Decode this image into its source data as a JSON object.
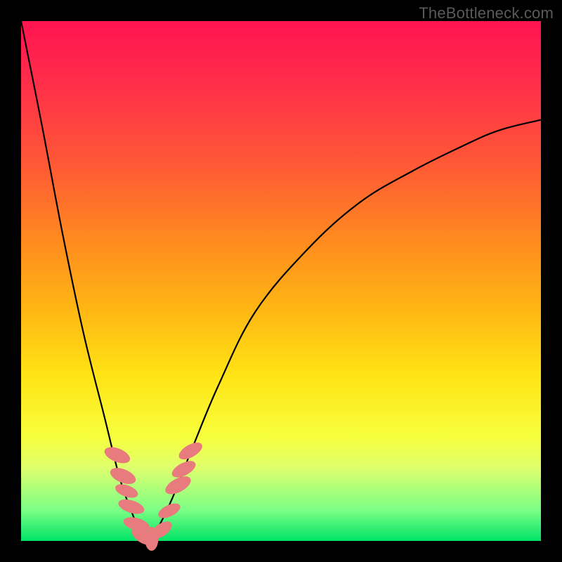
{
  "watermark": "TheBottleneck.com",
  "colors": {
    "frame": "#000000",
    "curve": "#000000",
    "bead": "#e77b7d",
    "gradient_top": "#ff1450",
    "gradient_bottom": "#00e468"
  },
  "chart_data": {
    "type": "line",
    "title": "",
    "xlabel": "",
    "ylabel": "",
    "xlim": [
      0,
      100
    ],
    "ylim": [
      0,
      100
    ],
    "grid": false,
    "legend": false,
    "notes": "Bottleneck-style curve. y≈100 means high bottleneck (top, red), y≈0 is optimal (bottom, green). Minimum of the V sits around x≈24, y≈0. Left arm rises steeply to y≈100 at x≈0; right arm rises to y≈81 at x≈100.",
    "series": [
      {
        "name": "left_arm",
        "x": [
          0,
          4,
          8,
          12,
          16,
          19,
          21.5,
          23,
          24
        ],
        "values": [
          100,
          80,
          59,
          40,
          24,
          12,
          5,
          1.5,
          0
        ]
      },
      {
        "name": "right_arm",
        "x": [
          24,
          26,
          29,
          33,
          38,
          45,
          55,
          65,
          75,
          85,
          92,
          100
        ],
        "values": [
          0,
          2,
          8,
          18,
          30,
          44,
          56,
          65,
          71,
          76,
          79,
          81
        ]
      }
    ],
    "beads": {
      "note": "Salmon lozenge beads clustered near the V bottom on both arms.",
      "points": [
        {
          "x": 18.5,
          "y": 16.5,
          "rx": 1.3,
          "ry": 2.6,
          "rot": -68
        },
        {
          "x": 19.6,
          "y": 12.5,
          "rx": 1.3,
          "ry": 2.6,
          "rot": -68
        },
        {
          "x": 20.3,
          "y": 9.6,
          "rx": 1.1,
          "ry": 2.3,
          "rot": -70
        },
        {
          "x": 21.2,
          "y": 6.6,
          "rx": 1.2,
          "ry": 2.6,
          "rot": -72
        },
        {
          "x": 22.2,
          "y": 3.2,
          "rx": 1.2,
          "ry": 2.6,
          "rot": -74
        },
        {
          "x": 23.3,
          "y": 0.9,
          "rx": 1.2,
          "ry": 2.3,
          "rot": -55
        },
        {
          "x": 25.1,
          "y": 0.4,
          "rx": 1.3,
          "ry": 2.3,
          "rot": 0
        },
        {
          "x": 27.0,
          "y": 2.1,
          "rx": 1.2,
          "ry": 2.3,
          "rot": 55
        },
        {
          "x": 28.5,
          "y": 5.8,
          "rx": 1.1,
          "ry": 2.3,
          "rot": 64
        },
        {
          "x": 30.2,
          "y": 10.7,
          "rx": 1.3,
          "ry": 2.7,
          "rot": 62
        },
        {
          "x": 31.3,
          "y": 13.8,
          "rx": 1.2,
          "ry": 2.5,
          "rot": 62
        },
        {
          "x": 32.6,
          "y": 17.3,
          "rx": 1.2,
          "ry": 2.5,
          "rot": 60
        }
      ]
    }
  }
}
